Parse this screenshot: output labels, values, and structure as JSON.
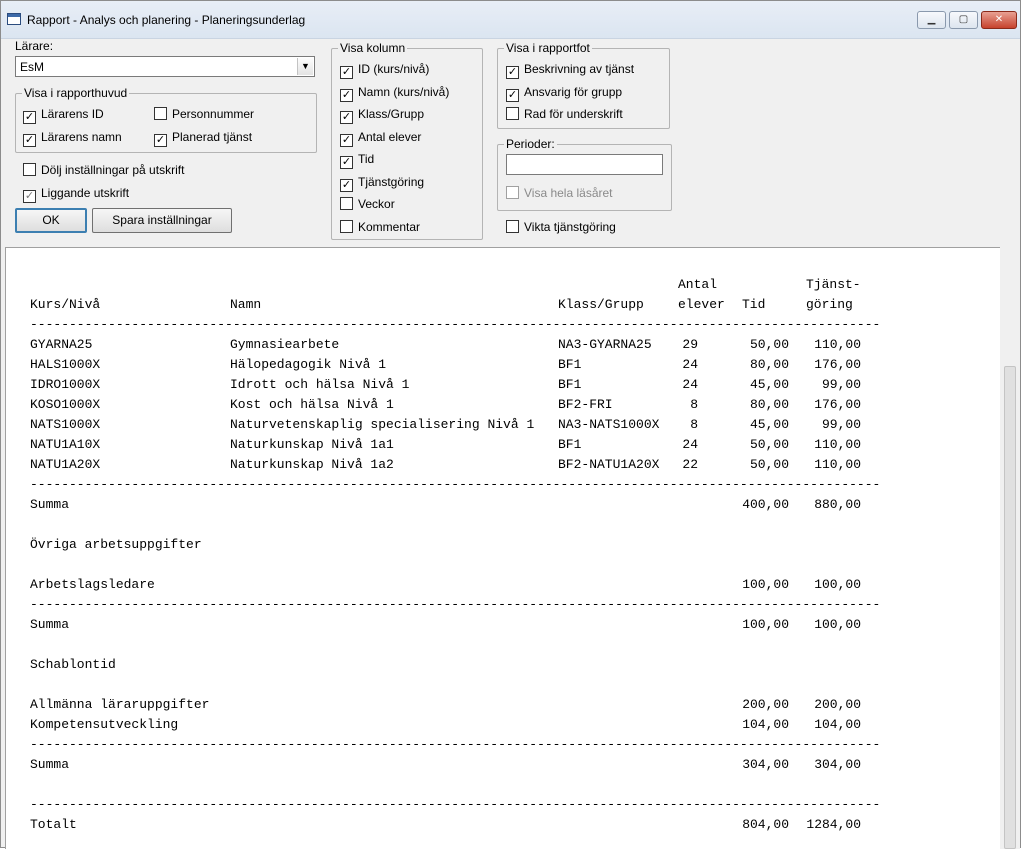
{
  "window": {
    "title": "Rapport - Analys och planering - Planeringsunderlag"
  },
  "teacher": {
    "label": "Lärare:",
    "value": "EsM"
  },
  "header_group": {
    "title": "Visa i rapporthuvud",
    "items": [
      {
        "label": "Lärarens ID",
        "checked": true
      },
      {
        "label": "Personnummer",
        "checked": false
      },
      {
        "label": "Lärarens namn",
        "checked": true
      },
      {
        "label": "Planerad tjänst",
        "checked": true
      }
    ]
  },
  "options": {
    "hide_settings": {
      "label": "Dölj inställningar på utskrift",
      "checked": false
    },
    "landscape": {
      "label": "Liggande utskrift",
      "checked": true
    }
  },
  "buttons": {
    "ok": "OK",
    "save": "Spara inställningar"
  },
  "columns_group": {
    "title": "Visa kolumn",
    "items": [
      {
        "label": "ID (kurs/nivå)",
        "checked": true
      },
      {
        "label": "Namn (kurs/nivå)",
        "checked": true
      },
      {
        "label": "Klass/Grupp",
        "checked": true
      },
      {
        "label": "Antal elever",
        "checked": true
      },
      {
        "label": "Tid",
        "checked": true
      },
      {
        "label": "Tjänstgöring",
        "checked": true
      },
      {
        "label": "Veckor",
        "checked": false
      },
      {
        "label": "Kommentar",
        "checked": false
      }
    ]
  },
  "footer_group": {
    "title": "Visa i rapportfot",
    "items": [
      {
        "label": "Beskrivning av tjänst",
        "checked": true
      },
      {
        "label": "Ansvarig för grupp",
        "checked": true
      },
      {
        "label": "Rad för underskrift",
        "checked": false
      }
    ]
  },
  "periods_group": {
    "title": "Perioder:",
    "input_value": "",
    "whole_year": {
      "label": "Visa hela läsåret",
      "checked": false
    }
  },
  "weight_service": {
    "label": "Vikta tjänstgöring",
    "checked": false
  },
  "report": {
    "header": {
      "antal_top": "Antal",
      "tjanst_top": "Tjänst-",
      "kurs": "Kurs/Nivå",
      "namn": "Namn",
      "klass": "Klass/Grupp",
      "antal_bottom": "elever",
      "tid": "Tid",
      "tjanst_bottom": "göring"
    },
    "separator": "-------------------------------------------------------------------------------------------------------------",
    "courses": [
      {
        "id": "GYARNA25",
        "name": "Gymnasiearbete",
        "group": "NA3-GYARNA25",
        "students": "29",
        "time": "50,00",
        "service": "110,00"
      },
      {
        "id": "HALS1000X",
        "name": "Hälopedagogik Nivå 1",
        "group": "BF1",
        "students": "24",
        "time": "80,00",
        "service": "176,00"
      },
      {
        "id": "IDRO1000X",
        "name": "Idrott och hälsa Nivå 1",
        "group": "BF1",
        "students": "24",
        "time": "45,00",
        "service": "99,00"
      },
      {
        "id": "KOSO1000X",
        "name": "Kost och hälsa Nivå 1",
        "group": "BF2-FRI",
        "students": "8",
        "time": "80,00",
        "service": "176,00"
      },
      {
        "id": "NATS1000X",
        "name": "Naturvetenskaplig specialisering Nivå 1",
        "group": "NA3-NATS1000X",
        "students": "8",
        "time": "45,00",
        "service": "99,00"
      },
      {
        "id": "NATU1A10X",
        "name": "Naturkunskap Nivå 1a1",
        "group": "BF1",
        "students": "24",
        "time": "50,00",
        "service": "110,00"
      },
      {
        "id": "NATU1A20X",
        "name": "Naturkunskap Nivå 1a2",
        "group": "BF2-NATU1A20X",
        "students": "22",
        "time": "50,00",
        "service": "110,00"
      }
    ],
    "sum1": {
      "label": "Summa",
      "time": "400,00",
      "service": "880,00"
    },
    "other_title": "Övriga arbetsuppgifter",
    "other_rows": [
      {
        "label": "Arbetslagsledare",
        "time": "100,00",
        "service": "100,00"
      }
    ],
    "sum2": {
      "label": "Summa",
      "time": "100,00",
      "service": "100,00"
    },
    "template_title": "Schablontid",
    "template_rows": [
      {
        "label": "Allmänna läraruppgifter",
        "time": "200,00",
        "service": "200,00"
      },
      {
        "label": "Kompetensutveckling",
        "time": "104,00",
        "service": "104,00"
      }
    ],
    "sum3": {
      "label": "Summa",
      "time": "304,00",
      "service": "304,00"
    },
    "total": {
      "label": "Totalt",
      "time": "804,00",
      "service": "1284,00"
    }
  }
}
